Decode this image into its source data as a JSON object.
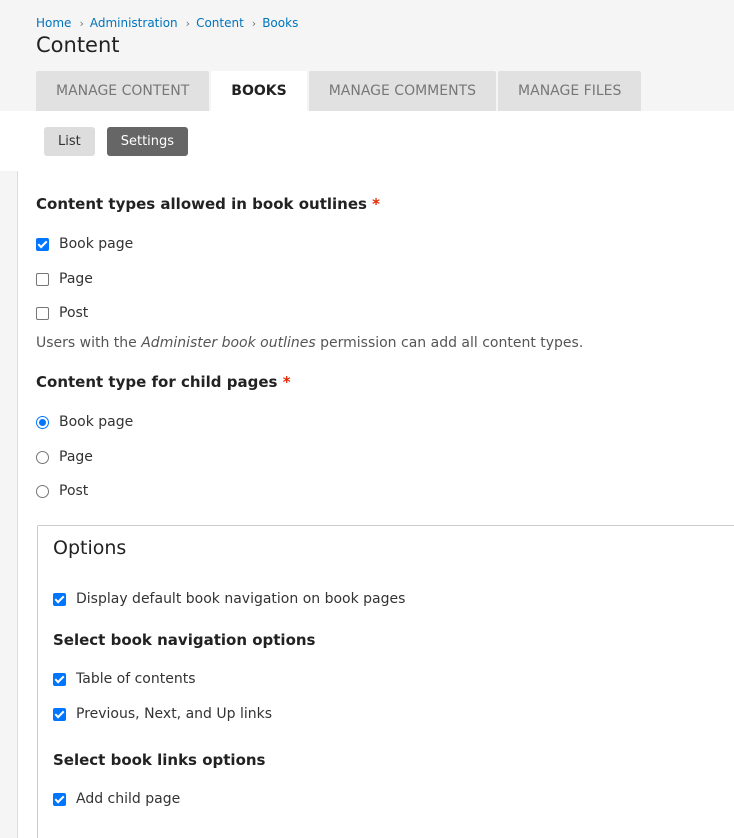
{
  "breadcrumb": [
    "Home",
    "Administration",
    "Content",
    "Books"
  ],
  "page_title": "Content",
  "tabs": [
    {
      "label": "Manage Content",
      "active": false
    },
    {
      "label": "Books",
      "active": true
    },
    {
      "label": "Manage Comments",
      "active": false
    },
    {
      "label": "Manage Files",
      "active": false
    }
  ],
  "subtabs": [
    {
      "label": "List",
      "active": false
    },
    {
      "label": "Settings",
      "active": true
    }
  ],
  "allowed_types": {
    "title": "Content types allowed in book outlines",
    "required_mark": "*",
    "options": [
      {
        "label": "Book page",
        "checked": true
      },
      {
        "label": "Page",
        "checked": false
      },
      {
        "label": "Post",
        "checked": false
      }
    ],
    "description_prefix": "Users with the ",
    "description_em": "Administer book outlines",
    "description_suffix": " permission can add all content types."
  },
  "child_type": {
    "title": "Content type for child pages",
    "required_mark": "*",
    "options": [
      {
        "label": "Book page",
        "selected": true
      },
      {
        "label": "Page",
        "selected": false
      },
      {
        "label": "Post",
        "selected": false
      }
    ]
  },
  "options_fieldset": {
    "title": "Options",
    "display_default_nav": {
      "label": "Display default book navigation on book pages",
      "checked": true
    },
    "nav_section_title": "Select book navigation options",
    "nav_options": [
      {
        "label": "Table of contents",
        "checked": true
      },
      {
        "label": "Previous, Next, and Up links",
        "checked": true
      }
    ],
    "links_section_title": "Select book links options",
    "links_options": [
      {
        "label": "Add child page",
        "checked": true
      }
    ]
  }
}
